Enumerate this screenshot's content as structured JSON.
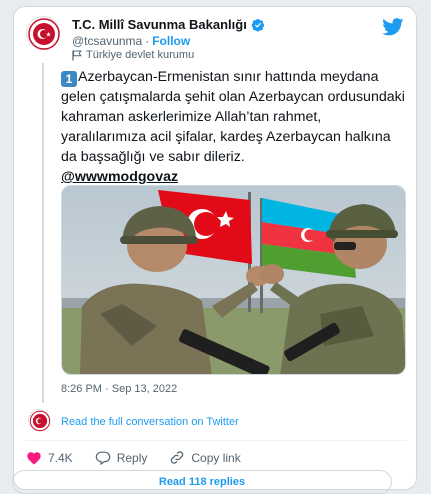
{
  "account": {
    "name": "T.C. Millî Savunma Bakanlığı",
    "handle": "@tcsavunma",
    "separator": "·",
    "follow_label": "Follow",
    "gov_label": "Türkiye devlet kurumu"
  },
  "tweet": {
    "keycap": "1",
    "text": "Azerbaycan-Ermenistan sınır hattında meydana gelen çatışmalarda şehit olan Azerbaycan ordusundaki kahraman askerlerimize Allah’tan rahmet, yaralılarımıza acil şifalar, kardeş Azerbaycan halkına da başsağlığı ve sabır dileriz.",
    "mention": "@wwwmodgovaz",
    "timestamp": "8:26 PM · Sep 13, 2022"
  },
  "thread": {
    "read_full": "Read the full conversation on Twitter"
  },
  "actions": {
    "likes": "7.4K",
    "reply_label": "Reply",
    "copy_label": "Copy link"
  },
  "replies_button": "Read 118 replies",
  "icons": {
    "verified": "verified-badge-icon",
    "twitter": "twitter-bird-icon",
    "flag": "flag-icon",
    "heart": "heart-icon",
    "reply": "reply-icon",
    "link": "link-icon"
  },
  "colors": {
    "accent": "#1d9bf0",
    "like": "#f91880",
    "keycap": "#3b88c3"
  }
}
